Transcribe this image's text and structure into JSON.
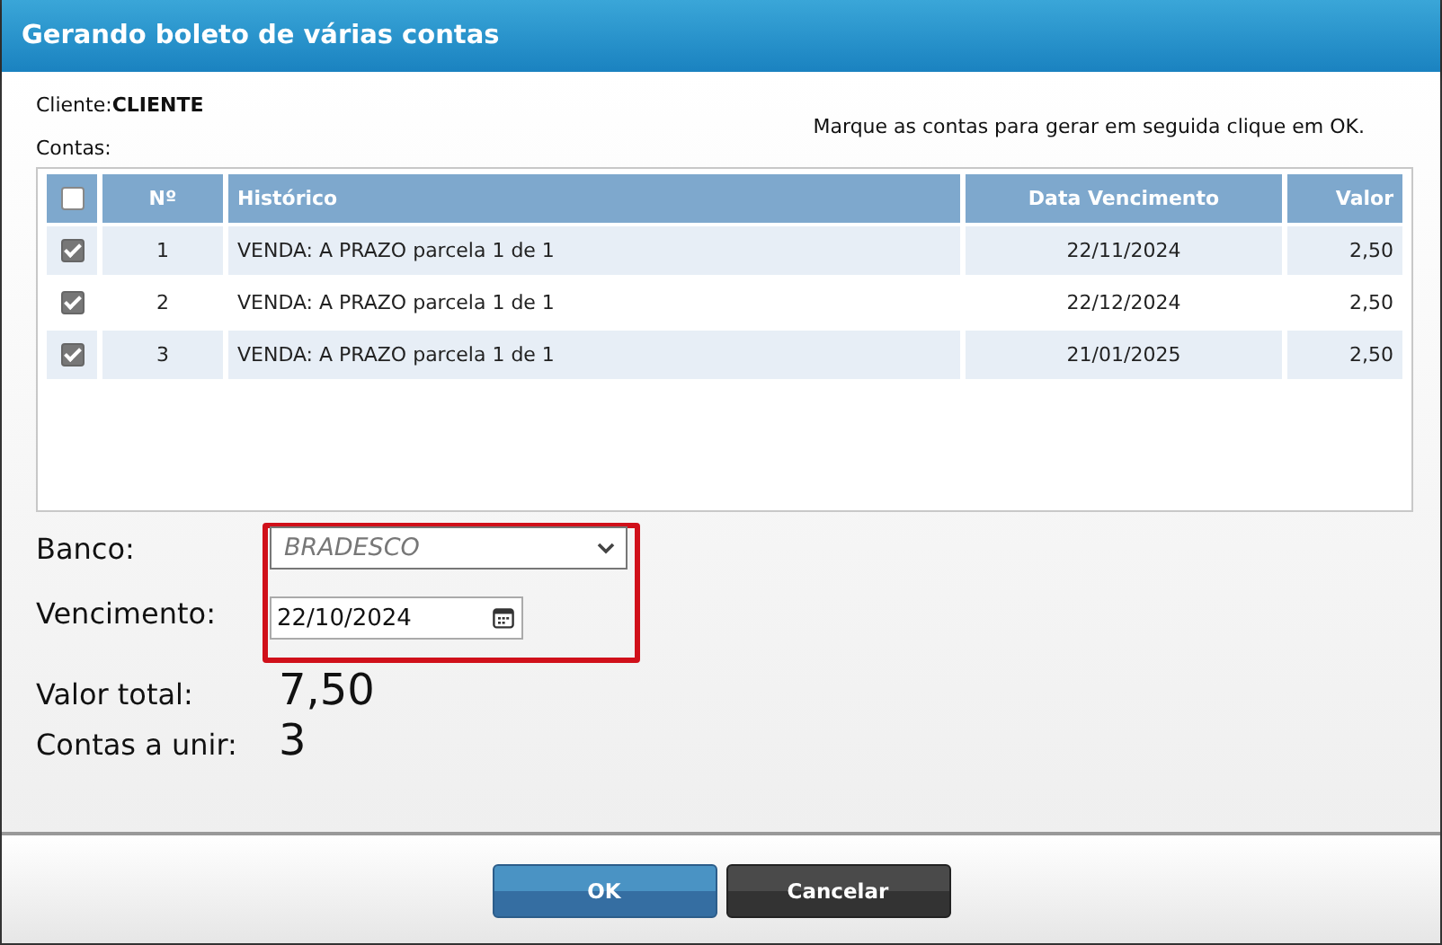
{
  "window": {
    "title": "Gerando boleto de várias contas"
  },
  "client": {
    "label": "Cliente:",
    "value": "CLIENTE"
  },
  "instruction": "Marque as contas para gerar em seguida clique em OK.",
  "accounts_label": "Contas:",
  "table": {
    "select_all_checked": false,
    "columns": [
      "Nº",
      "Histórico",
      "Data Vencimento",
      "Valor"
    ],
    "rows": [
      {
        "checked": true,
        "cells": [
          "1",
          "VENDA: A PRAZO parcela 1 de 1",
          "22/11/2024",
          "2,50"
        ]
      },
      {
        "checked": true,
        "cells": [
          "2",
          "VENDA: A PRAZO parcela 1 de 1",
          "22/12/2024",
          "2,50"
        ]
      },
      {
        "checked": true,
        "cells": [
          "3",
          "VENDA: A PRAZO parcela 1 de 1",
          "21/01/2025",
          "2,50"
        ]
      }
    ]
  },
  "form": {
    "bank_label": "Banco:",
    "bank_value": "BRADESCO",
    "due_label": "Vencimento:",
    "due_value": "22/10/2024",
    "highlighted": true
  },
  "totals": [
    {
      "label": "Valor total:",
      "value": "7,50"
    },
    {
      "label": "Contas a unir:",
      "value": "3"
    }
  ],
  "buttons": [
    {
      "label": "OK",
      "kind": "primary"
    },
    {
      "label": "Cancelar",
      "kind": "secondary"
    }
  ]
}
